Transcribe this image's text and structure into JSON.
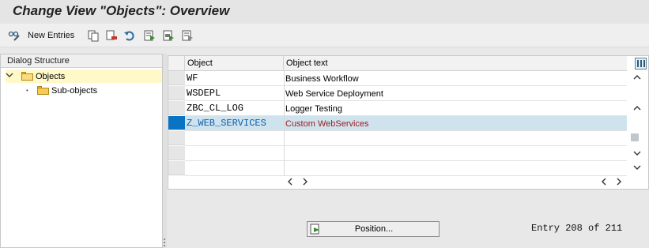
{
  "title": "Change View \"Objects\": Overview",
  "toolbar": {
    "new_entries_label": "New Entries",
    "icons": [
      "glasses-pencil-icon",
      "copy-icon",
      "delete-icon",
      "undo-icon",
      "select-all-icon",
      "select-block-icon",
      "deselect-all-icon"
    ]
  },
  "dialog_structure": {
    "header": "Dialog Structure",
    "items": [
      {
        "label": "Objects",
        "expanded": true,
        "selected": true
      },
      {
        "label": "Sub-objects",
        "expanded": false,
        "selected": false
      }
    ]
  },
  "table": {
    "columns": [
      "Object",
      "Object text"
    ],
    "rows": [
      {
        "object": "WF",
        "text": "Business Workflow",
        "selected": false
      },
      {
        "object": "WSDEPL",
        "text": "Web Service Deployment",
        "selected": false
      },
      {
        "object": "ZBC_CL_LOG",
        "text": "Logger Testing",
        "selected": false
      },
      {
        "object": "Z_WEB_SERVICES",
        "text": "Custom WebServices",
        "selected": true
      }
    ]
  },
  "footer": {
    "position_label": "Position...",
    "entry_text": "Entry 208 of 211"
  },
  "colors": {
    "selection": "#0a74c4",
    "selected_row": "#cfe3ef",
    "selected_text": "#9a1b1b",
    "tree_selection": "#fff8c8"
  }
}
